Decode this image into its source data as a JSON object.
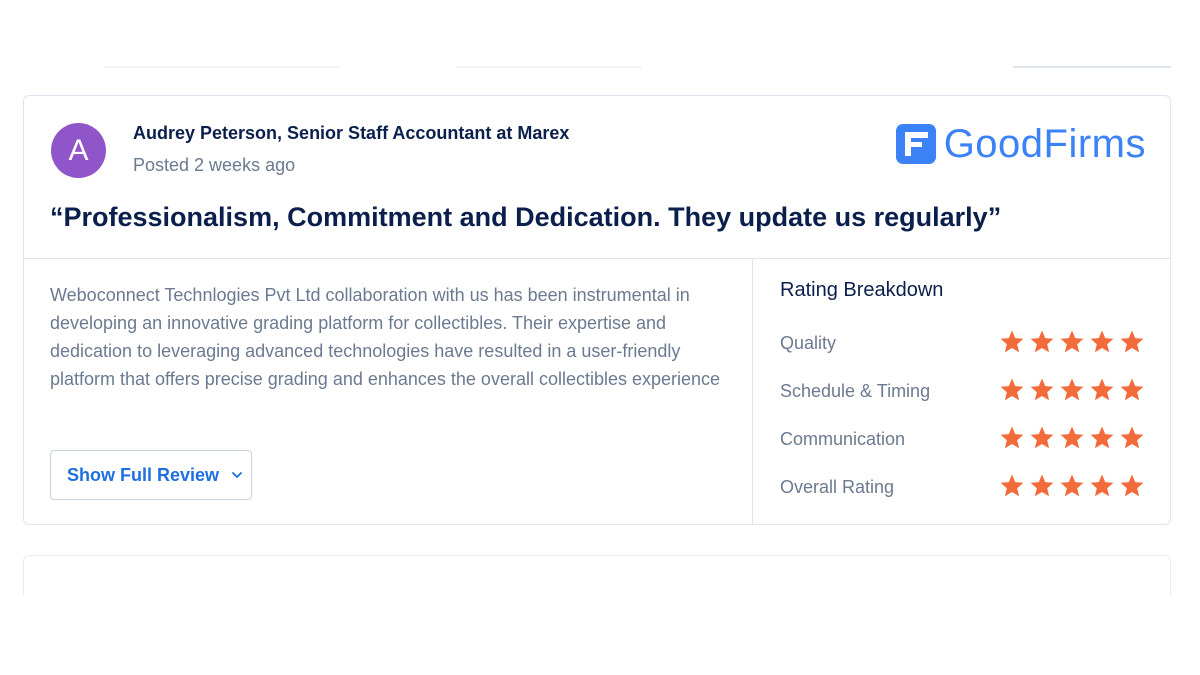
{
  "review": {
    "avatar_initial": "A",
    "reviewer": "Audrey Peterson, Senior Staff Accountant at Marex",
    "posted": "Posted 2 weeks ago",
    "brand": "GoodFirms",
    "headline": "“Professionalism, Commitment and Dedication. They update us regularly”",
    "body": "Weboconnect Technlogies Pvt Ltd collaboration with us has been instrumental in developing an innovative grading platform for collectibles. Their expertise and dedication to leveraging advanced technologies have resulted in a user-friendly platform that offers precise grading and enhances the overall collectibles experience",
    "show_full_review": "Show Full Review"
  },
  "rating_breakdown": {
    "title": "Rating Breakdown",
    "max_stars": 5,
    "rows": [
      {
        "label": "Quality",
        "stars": 5
      },
      {
        "label": "Schedule & Timing",
        "stars": 5
      },
      {
        "label": "Communication",
        "stars": 5
      },
      {
        "label": "Overall Rating",
        "stars": 5
      }
    ]
  },
  "colors": {
    "avatar": "#8f55c9",
    "brand_blue": "#3b82f6",
    "star": "#f26b3a",
    "link": "#1f6fe0",
    "heading": "#0b1f4d",
    "muted": "#6b7a90"
  }
}
